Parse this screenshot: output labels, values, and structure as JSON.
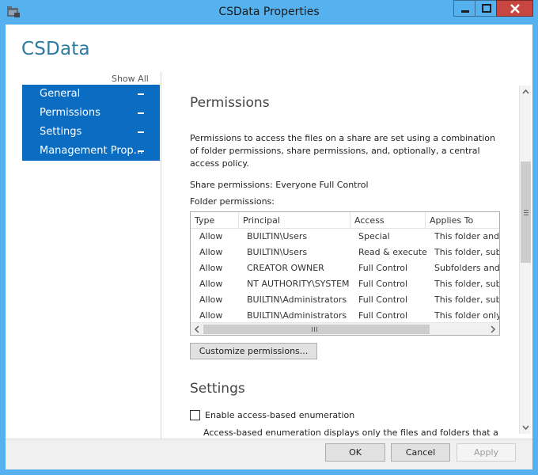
{
  "window": {
    "title": "CSData Properties",
    "accent_color": "#55b2ef",
    "close_color": "#c7463f",
    "buttons": {
      "minimize": "minimize-icon",
      "maximize": "maximize-icon",
      "close": "close-icon"
    }
  },
  "header": {
    "title": "CSData"
  },
  "sidebar": {
    "show_all": "Show All",
    "items": [
      {
        "label": "General"
      },
      {
        "label": "Permissions"
      },
      {
        "label": "Settings"
      },
      {
        "label": "Management Prop..."
      }
    ],
    "highlight_color": "#0a6dc2"
  },
  "permissions": {
    "title": "Permissions",
    "description": "Permissions to access the files on a share are set using a combination of folder permissions, share permissions, and, optionally, a central access policy.",
    "share_permissions_label": "Share permissions:",
    "share_permissions_value": "Everyone Full Control",
    "folder_permissions_label": "Folder permissions:",
    "columns": [
      "Type",
      "Principal",
      "Access",
      "Applies To"
    ],
    "rows": [
      {
        "type": "Allow",
        "principal": "BUILTIN\\Users",
        "access": "Special",
        "applies_to": "This folder and"
      },
      {
        "type": "Allow",
        "principal": "BUILTIN\\Users",
        "access": "Read & execute",
        "applies_to": "This folder, subf"
      },
      {
        "type": "Allow",
        "principal": "CREATOR OWNER",
        "access": "Full Control",
        "applies_to": "Subfolders and"
      },
      {
        "type": "Allow",
        "principal": "NT AUTHORITY\\SYSTEM",
        "access": "Full Control",
        "applies_to": "This folder, subf"
      },
      {
        "type": "Allow",
        "principal": "BUILTIN\\Administrators",
        "access": "Full Control",
        "applies_to": "This folder, subf"
      },
      {
        "type": "Allow",
        "principal": "BUILTIN\\Administrators",
        "access": "Full Control",
        "applies_to": "This folder only"
      }
    ],
    "customize_button": "Customize permissions..."
  },
  "settings": {
    "title": "Settings",
    "abe_label": "Enable access-based enumeration",
    "abe_checked": false,
    "abe_description": "Access-based enumeration displays only the files and folders that a"
  },
  "footer": {
    "ok": "OK",
    "cancel": "Cancel",
    "apply": "Apply"
  }
}
